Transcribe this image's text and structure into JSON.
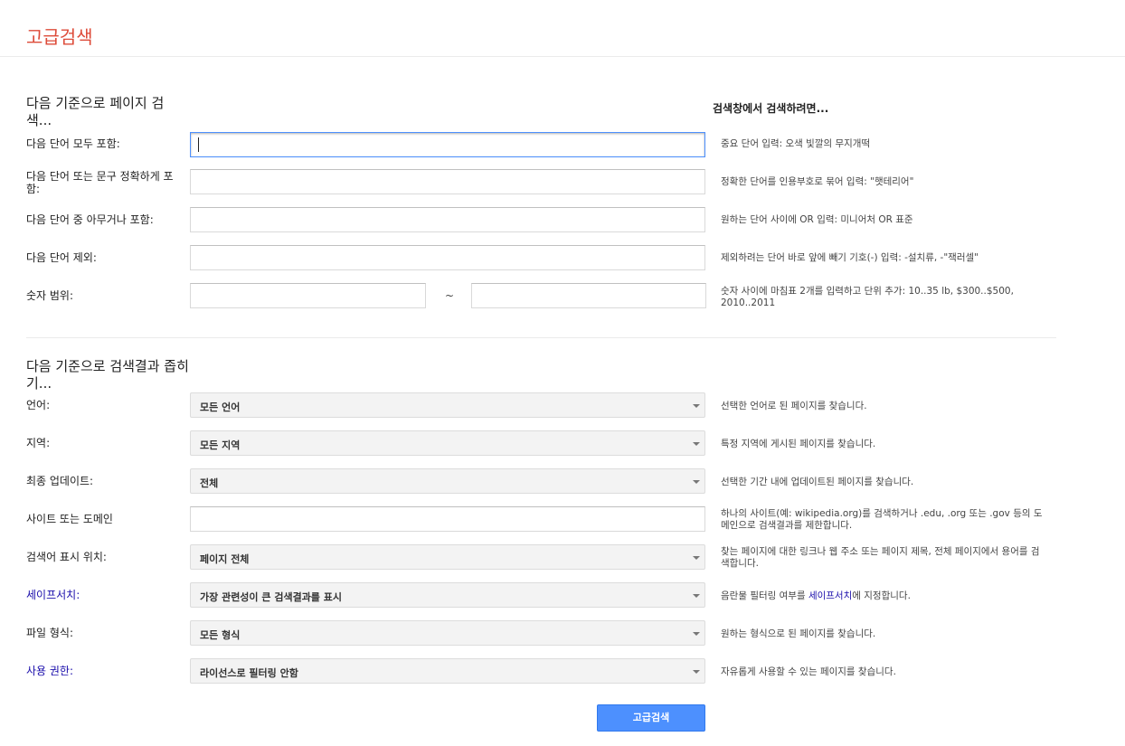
{
  "page": {
    "title": "고급검색"
  },
  "section1": {
    "heading": "다음 기준으로 페이지 검색...",
    "help_heading": "검색창에서 검색하려면...",
    "rows": [
      {
        "label": "다음 단어 모두 포함:",
        "value": "",
        "help": "중요 단어 입력: 오색 빛깔의 무지개떡"
      },
      {
        "label": "다음 단어 또는 문구 정확하게 포함:",
        "value": "",
        "help": "정확한 단어를 인용부호로 묶어 입력: \"햇테리어\""
      },
      {
        "label": "다음 단어 중 아무거나 포함:",
        "value": "",
        "help": "원하는 단어 사이에 OR 입력: 미니어처 OR 표준"
      },
      {
        "label": "다음 단어 제외:",
        "value": "",
        "help": "제외하려는 단어 바로 앞에 빼기 기호(-) 입력: -설치류, -\"잭러셀\""
      }
    ],
    "range": {
      "label": "숫자 범위:",
      "from": "",
      "separator": "~",
      "to": "",
      "help": "숫자 사이에 마침표 2개를 입력하고 단위 추가: 10..35 lb, $300..$500, 2010..2011"
    }
  },
  "section2": {
    "heading": "다음 기준으로 검색결과 좁히기...",
    "language": {
      "label": "언어:",
      "value": "모든 언어",
      "help": "선택한 언어로 된 페이지를 찾습니다."
    },
    "region": {
      "label": "지역:",
      "value": "모든 지역",
      "help": "특정 지역에 게시된 페이지를 찾습니다."
    },
    "updated": {
      "label": "최종 업데이트:",
      "value": "전체",
      "help": "선택한 기간 내에 업데이트된 페이지를 찾습니다."
    },
    "site": {
      "label": "사이트 또는 도메인",
      "value": "",
      "help": "하나의 사이트(예: wikipedia.org)를 검색하거나 .edu, .org 또는 .gov 등의 도메인으로 검색결과를 제한합니다."
    },
    "terms_location": {
      "label": "검색어 표시 위치:",
      "value": "페이지 전체",
      "help": "찾는 페이지에 대한 링크나 웹 주소 또는 페이지 제목, 전체 페이지에서 용어를 검색합니다."
    },
    "safesearch": {
      "label": "세이프서치:",
      "value": "가장 관련성이 큰 검색결과를 표시",
      "help_pre": "음란물 필터링 여부를 ",
      "help_link": "세이프서치",
      "help_post": "에 지정합니다."
    },
    "filetype": {
      "label": "파일 형식:",
      "value": "모든 형식",
      "help": "원하는 형식으로 된 페이지를 찾습니다."
    },
    "rights": {
      "label": "사용 권한:",
      "value": "라이선스로 필터링 안함",
      "help": "자유롭게 사용할 수 있는 페이지를 찾습니다."
    }
  },
  "submit": {
    "label": "고급검색"
  },
  "colors": {
    "title": "#dd4b39",
    "link": "#1a0dab",
    "button": "#4d90fe"
  }
}
